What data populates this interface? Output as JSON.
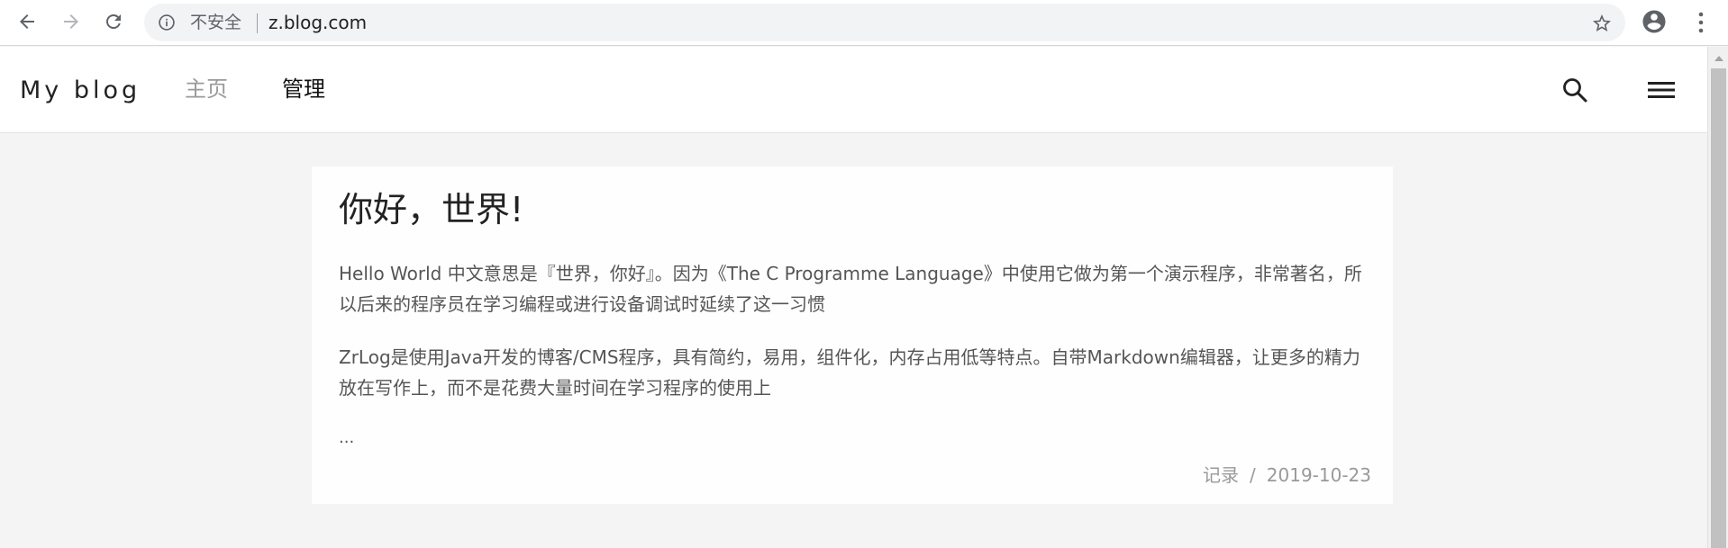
{
  "browser": {
    "security_label": "不安全",
    "url": "z.blog.com"
  },
  "site": {
    "title": "My blog",
    "nav": {
      "home": "主页",
      "admin": "管理"
    }
  },
  "post": {
    "title": "你好，世界!",
    "paragraphs": [
      "Hello World 中文意思是『世界，你好』。因为《The C Programme Language》中使用它做为第一个演示程序，非常著名，所以后来的程序员在学习编程或进行设备调试时延续了这一习惯",
      "ZrLog是使用Java开发的博客/CMS程序，具有简约，易用，组件化，内存占用低等特点。自带Markdown编辑器，让更多的精力放在写作上，而不是花费大量时间在学习程序的使用上"
    ],
    "ellipsis": "...",
    "category": "记录",
    "meta_separator": "/",
    "date": "2019-10-23"
  },
  "icons": {
    "back": "back-arrow-icon",
    "forward": "forward-arrow-icon",
    "reload": "reload-icon",
    "info": "info-icon",
    "bookmark": "star-icon",
    "profile": "account-circle-icon",
    "menu": "more-vert-icon",
    "search": "search-icon",
    "hamburger": "hamburger-menu-icon"
  },
  "colors": {
    "page_background": "#f4f4f4",
    "nav_inactive": "#9a9a9a",
    "nav_active": "#111111",
    "text_body": "#555555",
    "meta_text": "#999999"
  }
}
